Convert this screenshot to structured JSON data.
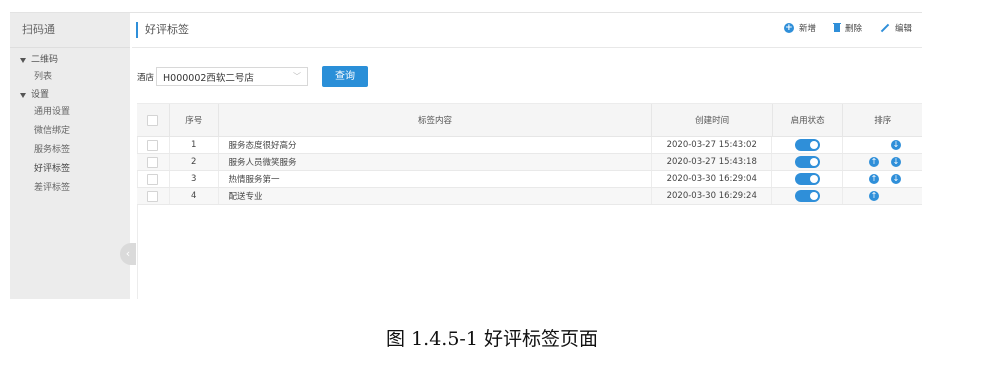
{
  "sidebar": {
    "app_name": "扫码通",
    "groups": [
      {
        "label": "二维码",
        "items": [
          "列表"
        ]
      },
      {
        "label": "设置",
        "items": [
          "通用设置",
          "微信绑定",
          "服务标签",
          "好评标签",
          "差评标签"
        ]
      }
    ],
    "collapse_icon": "chevron-left-icon"
  },
  "header": {
    "title": "好评标签",
    "actions": {
      "add": "新增",
      "delete": "删除",
      "edit": "编辑"
    }
  },
  "filter": {
    "label": "酒店",
    "selected": "H000002西软二号店",
    "query_button": "查询"
  },
  "table": {
    "columns": {
      "no": "序号",
      "content": "标签内容",
      "created": "创建时间",
      "status": "启用状态",
      "sort": "排序"
    },
    "rows": [
      {
        "no": "1",
        "content": "服务态度很好高分",
        "created": "2020-03-27 15:43:02",
        "enabled": true,
        "up": false,
        "down": true
      },
      {
        "no": "2",
        "content": "服务人员微笑服务",
        "created": "2020-03-27 15:43:18",
        "enabled": true,
        "up": true,
        "down": true
      },
      {
        "no": "3",
        "content": "热情服务第一",
        "created": "2020-03-30 16:29:04",
        "enabled": true,
        "up": true,
        "down": true
      },
      {
        "no": "4",
        "content": "配送专业",
        "created": "2020-03-30 16:29:24",
        "enabled": true,
        "up": true,
        "down": false
      }
    ]
  },
  "caption": "图 1.4.5-1 好评标签页面",
  "colors": {
    "accent": "#2f8fd9",
    "sidebar_bg": "#ececec"
  }
}
